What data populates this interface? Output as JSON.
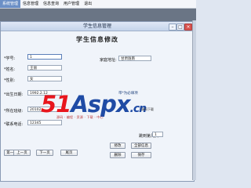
{
  "menubar": {
    "items": [
      {
        "label": "系统管理"
      },
      {
        "label": "信息管理"
      },
      {
        "label": "信息查询"
      },
      {
        "label": "用户管理"
      },
      {
        "label": "退出"
      }
    ]
  },
  "window": {
    "title": "学生信息管理",
    "min_glyph": "–",
    "max_glyph": "□",
    "close_glyph": "×"
  },
  "form": {
    "heading": "学生信息修改",
    "id_label": "*学号:",
    "id_value": "1",
    "name_label": "*姓名:",
    "name_value": "王丽",
    "gender_label": "*性别:",
    "gender_value": "女",
    "birth_label": "*出生日期:",
    "birth_value": "1992.2.12",
    "class_label": "*所在班级:",
    "class_value": "20102",
    "phone_label": "*联系电话:",
    "phone_value": "12345",
    "address_label": "家庭地址:",
    "address_value": "甘肃陇南",
    "hint_text": "带*为必填项",
    "page_label": "跳到第几页:",
    "page_value": "1"
  },
  "buttons": {
    "first": "第一页",
    "prev": "上一页",
    "next": "下一页",
    "last": "尾页",
    "modify": "修改",
    "all_info": "全部信息",
    "delete": "删除",
    "save": "保存"
  },
  "watermark": {
    "part1": "51",
    "part2": "Aspx",
    "part3": ".cn",
    "tagline": "源码 · 编程 · 资源 · 下载 · 中心",
    "small": "源码下载"
  },
  "colors": {
    "menu_active": "#6b8fc6",
    "workspace": "#6a7585",
    "window_bg": "#f0f4fa",
    "watermark_red": "#e8161d",
    "watermark_blue": "#1f4ba5"
  }
}
